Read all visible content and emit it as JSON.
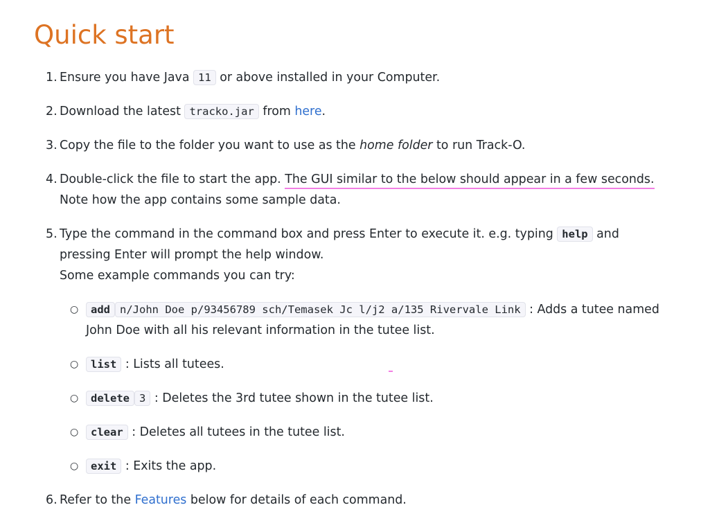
{
  "title": "Quick start",
  "steps": [
    {
      "num": "1.",
      "t1": "Ensure you have Java ",
      "code": "11",
      "t2": " or above installed in your Computer."
    },
    {
      "num": "2.",
      "t1": "Download the latest ",
      "code": "tracko.jar",
      "t2": " from ",
      "link": "here",
      "t3": "."
    },
    {
      "num": "3.",
      "t1": "Copy the file to the folder you want to use as the ",
      "em": "home folder",
      "t2": " to run Track-O."
    },
    {
      "num": "4.",
      "t1": "Double-click the file to start the app. ",
      "highlight": "The GUI similar to the below should appear in a few seconds.",
      "t2": "Note how the app contains some sample data."
    },
    {
      "num": "5.",
      "t1": "Type the command in the command box and press Enter to execute it. e.g. typing ",
      "code": "help",
      "t2": " and pressing Enter will prompt the help window.",
      "t3": "Some example commands you can try:"
    },
    {
      "num": "6.",
      "t1": "Refer to the ",
      "link": "Features",
      "t2": " below for details of each command."
    }
  ],
  "examples": [
    {
      "cmd": "add",
      "args": "n/John Doe p/93456789 sch/Temasek Jc l/j2 a/135 Rivervale Link",
      "desc": " : Adds a tutee named John Doe with all his relevant information in the tutee list."
    },
    {
      "cmd": "list",
      "desc": " : Lists all tutees."
    },
    {
      "cmd": "delete",
      "args": "3",
      "desc": " : Deletes the 3rd tutee shown in the tutee list."
    },
    {
      "cmd": "clear",
      "desc": " : Deletes all tutees in the tutee list."
    },
    {
      "cmd": "exit",
      "desc": " : Exits the app."
    }
  ],
  "bullet_glyph": "○",
  "colors": {
    "heading": "#dd7323",
    "link": "#2f6fce",
    "highlight_underline": "#f27fe3"
  }
}
